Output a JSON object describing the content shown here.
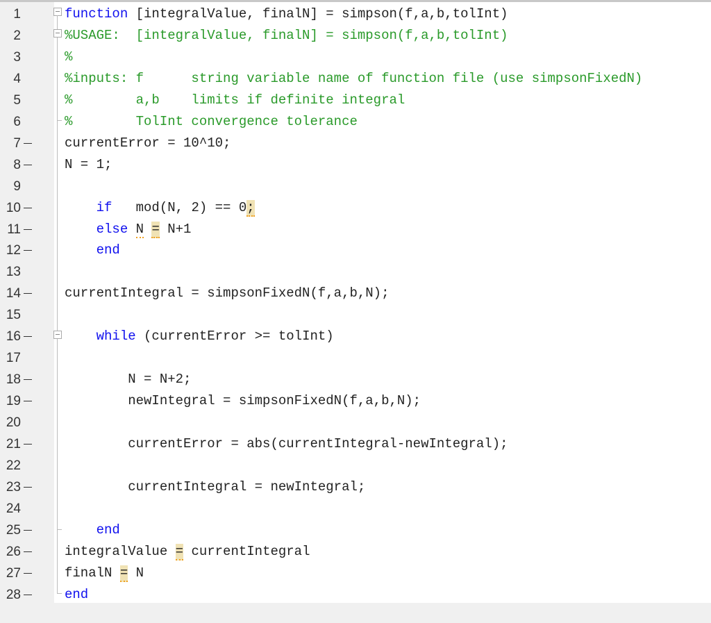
{
  "editor": {
    "lines": [
      {
        "n": "1",
        "dash": false,
        "html": [
          {
            "t": "function",
            "c": "kw"
          },
          {
            "t": " [integralValue, finalN] = simpson(f,a,b,tolInt)",
            "c": ""
          }
        ]
      },
      {
        "n": "2",
        "dash": false,
        "html": [
          {
            "t": "%USAGE:  [integralValue, finalN] = simpson(f,a,b,tolInt)",
            "c": "cm"
          }
        ]
      },
      {
        "n": "3",
        "dash": false,
        "html": [
          {
            "t": "%",
            "c": "cm"
          }
        ]
      },
      {
        "n": "4",
        "dash": false,
        "html": [
          {
            "t": "%inputs: f      string variable name of function file (use simpsonFixedN)",
            "c": "cm"
          }
        ]
      },
      {
        "n": "5",
        "dash": false,
        "html": [
          {
            "t": "%        a,b    limits if definite integral",
            "c": "cm"
          }
        ]
      },
      {
        "n": "6",
        "dash": false,
        "html": [
          {
            "t": "%        TolInt convergence tolerance",
            "c": "cm"
          }
        ]
      },
      {
        "n": "7",
        "dash": true,
        "html": [
          {
            "t": "currentError = 10^10;",
            "c": ""
          }
        ]
      },
      {
        "n": "8",
        "dash": true,
        "html": [
          {
            "t": "N = 1;",
            "c": ""
          }
        ]
      },
      {
        "n": "9",
        "dash": false,
        "html": []
      },
      {
        "n": "10",
        "dash": true,
        "html": [
          {
            "t": "    ",
            "c": ""
          },
          {
            "t": "if",
            "c": "kw"
          },
          {
            "t": "   mod(N, 2) == 0",
            "c": ""
          },
          {
            "t": ";",
            "c": "warn"
          }
        ]
      },
      {
        "n": "11",
        "dash": true,
        "html": [
          {
            "t": "    ",
            "c": ""
          },
          {
            "t": "else",
            "c": "kw"
          },
          {
            "t": " ",
            "c": ""
          },
          {
            "t": "N",
            "c": "warnu"
          },
          {
            "t": " ",
            "c": ""
          },
          {
            "t": "=",
            "c": "warn"
          },
          {
            "t": " N+1",
            "c": ""
          }
        ]
      },
      {
        "n": "12",
        "dash": true,
        "html": [
          {
            "t": "    ",
            "c": ""
          },
          {
            "t": "end",
            "c": "kw"
          }
        ]
      },
      {
        "n": "13",
        "dash": false,
        "html": []
      },
      {
        "n": "14",
        "dash": true,
        "html": [
          {
            "t": "currentIntegral = simpsonFixedN(f,a,b,N);",
            "c": ""
          }
        ]
      },
      {
        "n": "15",
        "dash": false,
        "html": []
      },
      {
        "n": "16",
        "dash": true,
        "html": [
          {
            "t": "    ",
            "c": ""
          },
          {
            "t": "while",
            "c": "kw"
          },
          {
            "t": " (currentError >= tolInt)",
            "c": ""
          }
        ]
      },
      {
        "n": "17",
        "dash": false,
        "html": []
      },
      {
        "n": "18",
        "dash": true,
        "html": [
          {
            "t": "        N = N+2;",
            "c": ""
          }
        ]
      },
      {
        "n": "19",
        "dash": true,
        "html": [
          {
            "t": "        newIntegral = simpsonFixedN(f,a,b,N);",
            "c": ""
          }
        ]
      },
      {
        "n": "20",
        "dash": false,
        "html": []
      },
      {
        "n": "21",
        "dash": true,
        "html": [
          {
            "t": "        currentError = abs(currentIntegral-newIntegral);",
            "c": ""
          }
        ]
      },
      {
        "n": "22",
        "dash": false,
        "html": []
      },
      {
        "n": "23",
        "dash": true,
        "html": [
          {
            "t": "        currentIntegral = newIntegral;",
            "c": ""
          }
        ]
      },
      {
        "n": "24",
        "dash": false,
        "html": []
      },
      {
        "n": "25",
        "dash": true,
        "html": [
          {
            "t": "    ",
            "c": ""
          },
          {
            "t": "end",
            "c": "kw"
          }
        ]
      },
      {
        "n": "26",
        "dash": true,
        "html": [
          {
            "t": "integralValue ",
            "c": ""
          },
          {
            "t": "=",
            "c": "warn"
          },
          {
            "t": " currentIntegral",
            "c": ""
          }
        ]
      },
      {
        "n": "27",
        "dash": true,
        "html": [
          {
            "t": "finalN ",
            "c": ""
          },
          {
            "t": "=",
            "c": "warn"
          },
          {
            "t": " N",
            "c": ""
          }
        ]
      },
      {
        "n": "28",
        "dash": true,
        "html": [
          {
            "t": "end",
            "c": "kw"
          }
        ]
      }
    ]
  },
  "colors": {
    "keyword": "#1010ee",
    "comment": "#2a9a2a",
    "warning_bg": "#f0e2b4"
  }
}
